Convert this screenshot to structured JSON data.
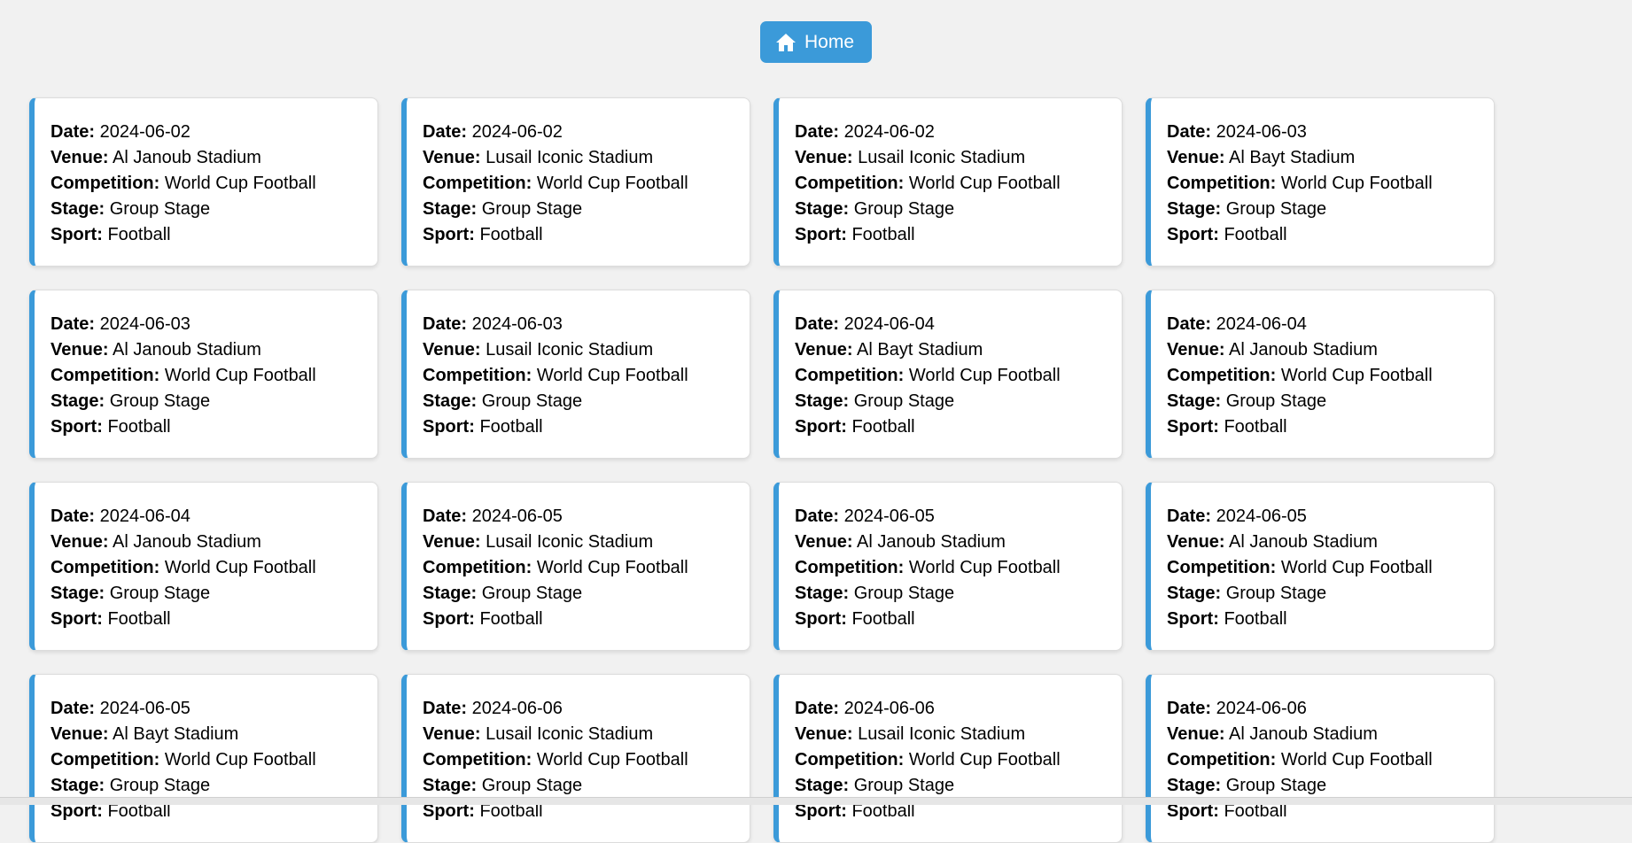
{
  "nav": {
    "home_label": "Home",
    "home_icon": "home-icon",
    "accent_color": "#3b9ad9"
  },
  "field_labels": {
    "date": "Date:",
    "venue": "Venue:",
    "competition": "Competition:",
    "stage": "Stage:",
    "sport": "Sport:"
  },
  "matches": [
    {
      "date": "2024-06-02",
      "venue": "Al Janoub Stadium",
      "competition": "World Cup Football",
      "stage": "Group Stage",
      "sport": "Football"
    },
    {
      "date": "2024-06-02",
      "venue": "Lusail Iconic Stadium",
      "competition": "World Cup Football",
      "stage": "Group Stage",
      "sport": "Football"
    },
    {
      "date": "2024-06-02",
      "venue": "Lusail Iconic Stadium",
      "competition": "World Cup Football",
      "stage": "Group Stage",
      "sport": "Football"
    },
    {
      "date": "2024-06-03",
      "venue": "Al Bayt Stadium",
      "competition": "World Cup Football",
      "stage": "Group Stage",
      "sport": "Football"
    },
    {
      "date": "2024-06-03",
      "venue": "Al Janoub Stadium",
      "competition": "World Cup Football",
      "stage": "Group Stage",
      "sport": "Football"
    },
    {
      "date": "2024-06-03",
      "venue": "Lusail Iconic Stadium",
      "competition": "World Cup Football",
      "stage": "Group Stage",
      "sport": "Football"
    },
    {
      "date": "2024-06-04",
      "venue": "Al Bayt Stadium",
      "competition": "World Cup Football",
      "stage": "Group Stage",
      "sport": "Football"
    },
    {
      "date": "2024-06-04",
      "venue": "Al Janoub Stadium",
      "competition": "World Cup Football",
      "stage": "Group Stage",
      "sport": "Football"
    },
    {
      "date": "2024-06-04",
      "venue": "Al Janoub Stadium",
      "competition": "World Cup Football",
      "stage": "Group Stage",
      "sport": "Football"
    },
    {
      "date": "2024-06-05",
      "venue": "Lusail Iconic Stadium",
      "competition": "World Cup Football",
      "stage": "Group Stage",
      "sport": "Football"
    },
    {
      "date": "2024-06-05",
      "venue": "Al Janoub Stadium",
      "competition": "World Cup Football",
      "stage": "Group Stage",
      "sport": "Football"
    },
    {
      "date": "2024-06-05",
      "venue": "Al Janoub Stadium",
      "competition": "World Cup Football",
      "stage": "Group Stage",
      "sport": "Football"
    },
    {
      "date": "2024-06-05",
      "venue": "Al Bayt Stadium",
      "competition": "World Cup Football",
      "stage": "Group Stage",
      "sport": "Football"
    },
    {
      "date": "2024-06-06",
      "venue": "Lusail Iconic Stadium",
      "competition": "World Cup Football",
      "stage": "Group Stage",
      "sport": "Football"
    },
    {
      "date": "2024-06-06",
      "venue": "Lusail Iconic Stadium",
      "competition": "World Cup Football",
      "stage": "Group Stage",
      "sport": "Football"
    },
    {
      "date": "2024-06-06",
      "venue": "Al Janoub Stadium",
      "competition": "World Cup Football",
      "stage": "Group Stage",
      "sport": "Football"
    }
  ]
}
